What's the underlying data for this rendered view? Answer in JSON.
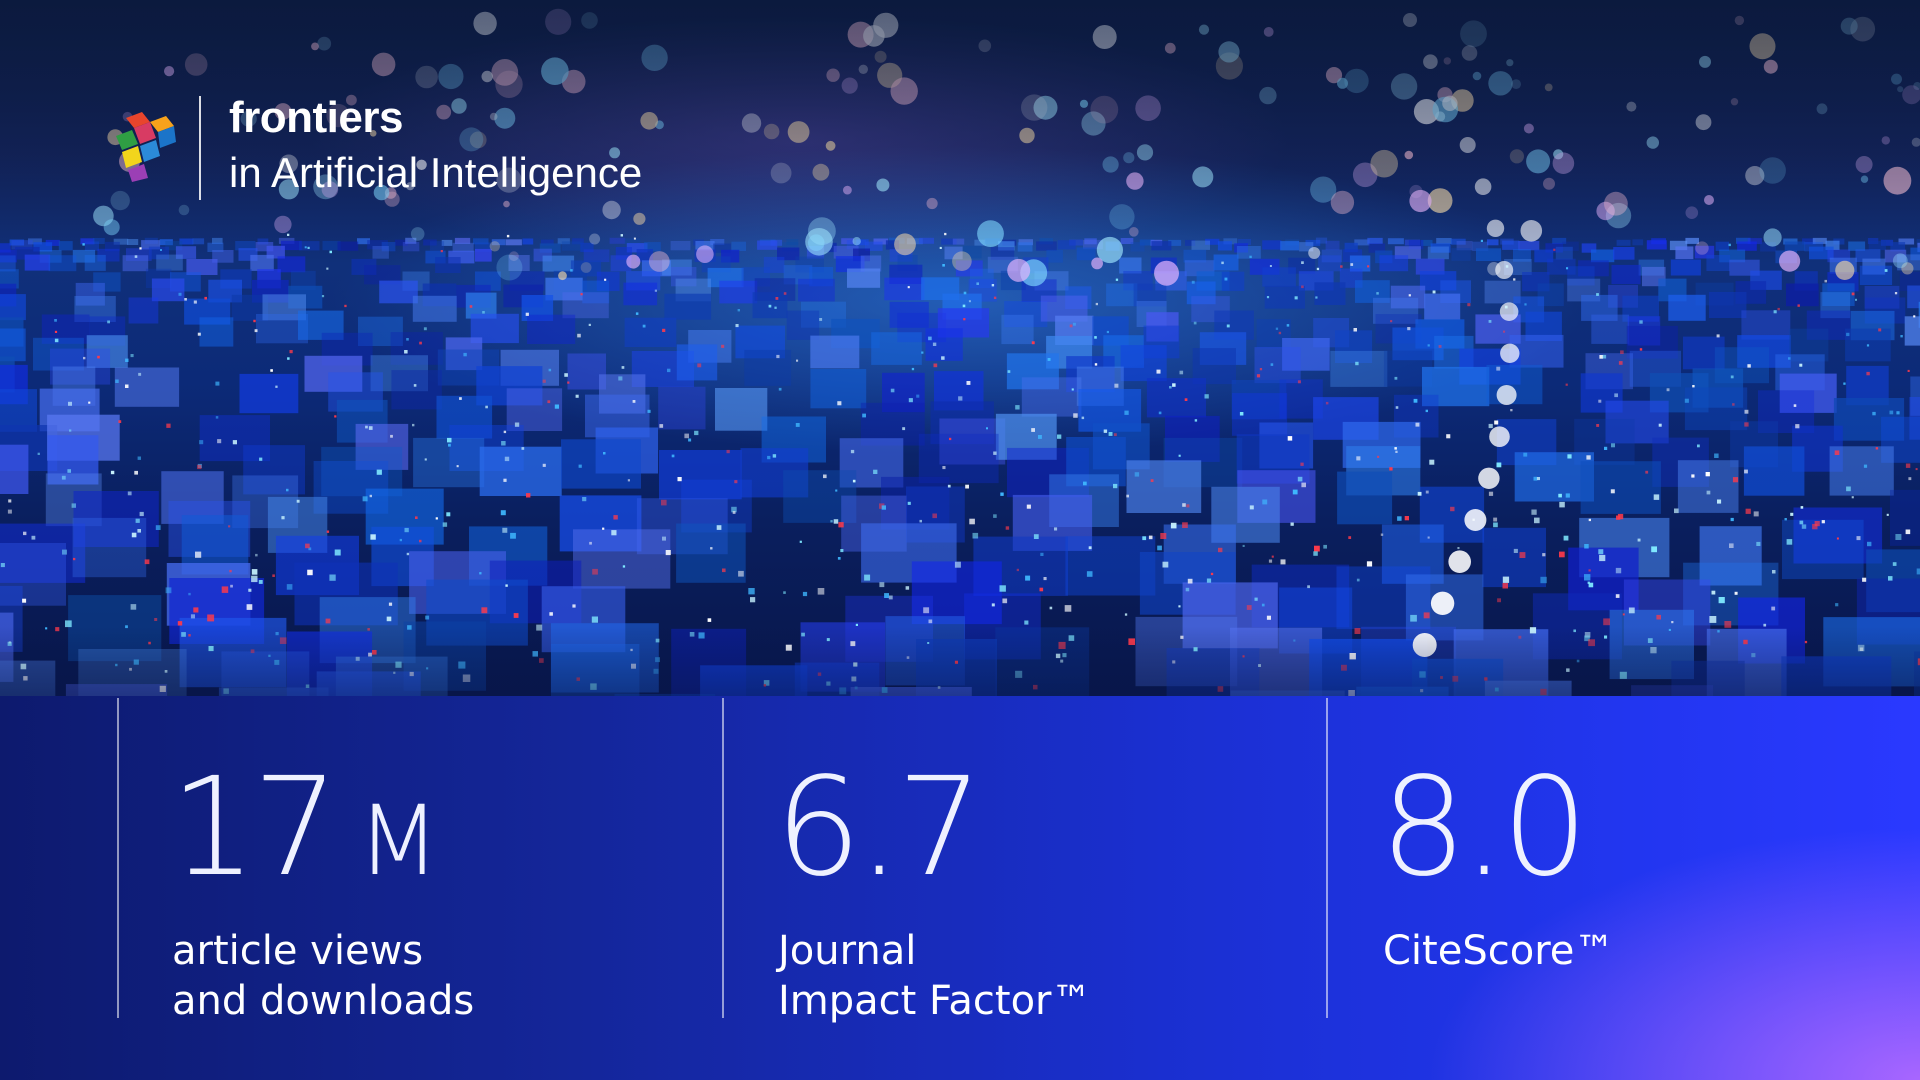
{
  "brand": {
    "name": "frontiers",
    "journal": "in Artificial Intelligence",
    "logo_icon": "frontiers-cube-logo-icon",
    "logo_colors": [
      "#e8452c",
      "#f7a21b",
      "#2f9e44",
      "#1b74c9",
      "#f2d51c"
    ]
  },
  "stats": [
    {
      "value": "17",
      "unit": "M",
      "label_line1": "article views",
      "label_line2": "and downloads"
    },
    {
      "value": "6.7",
      "unit": "",
      "label_line1": "Journal",
      "label_line2": "Impact Factor™"
    },
    {
      "value": "8.0",
      "unit": "",
      "label_line1": "CiteScore™",
      "label_line2": ""
    }
  ],
  "colors": {
    "band_left": "#0d1a6e",
    "band_right": "#2a39ff",
    "band_glow": "#be6eff",
    "text": "#ffffff"
  }
}
